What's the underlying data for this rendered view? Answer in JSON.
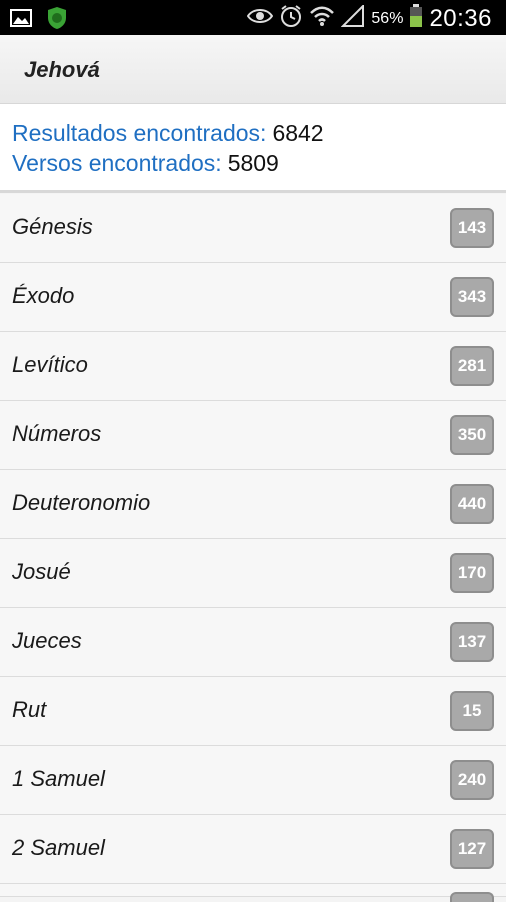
{
  "status_bar": {
    "battery_percent": "56%",
    "time": "20:36",
    "icons": [
      "image-icon",
      "shield-lion-icon",
      "eye-icon",
      "alarm-icon",
      "wifi-icon",
      "signal-icon",
      "battery-icon"
    ]
  },
  "header": {
    "title": "Jehová"
  },
  "summary": {
    "results_label": "Resultados encontrados:",
    "results_value": "6842",
    "verses_label": "Versos encontrados:",
    "verses_value": "5809"
  },
  "books": [
    {
      "name": "Génesis",
      "count": "143"
    },
    {
      "name": "Éxodo",
      "count": "343"
    },
    {
      "name": "Levítico",
      "count": "281"
    },
    {
      "name": "Números",
      "count": "350"
    },
    {
      "name": "Deuteronomio",
      "count": "440"
    },
    {
      "name": "Josué",
      "count": "170"
    },
    {
      "name": "Jueces",
      "count": "137"
    },
    {
      "name": "Rut",
      "count": "15"
    },
    {
      "name": "1 Samuel",
      "count": "240"
    },
    {
      "name": "2 Samuel",
      "count": "127"
    }
  ],
  "colors": {
    "accent_blue": "#1f6fc2",
    "badge_gray": "#a9a9a9",
    "battery_green": "#8bc34a"
  }
}
